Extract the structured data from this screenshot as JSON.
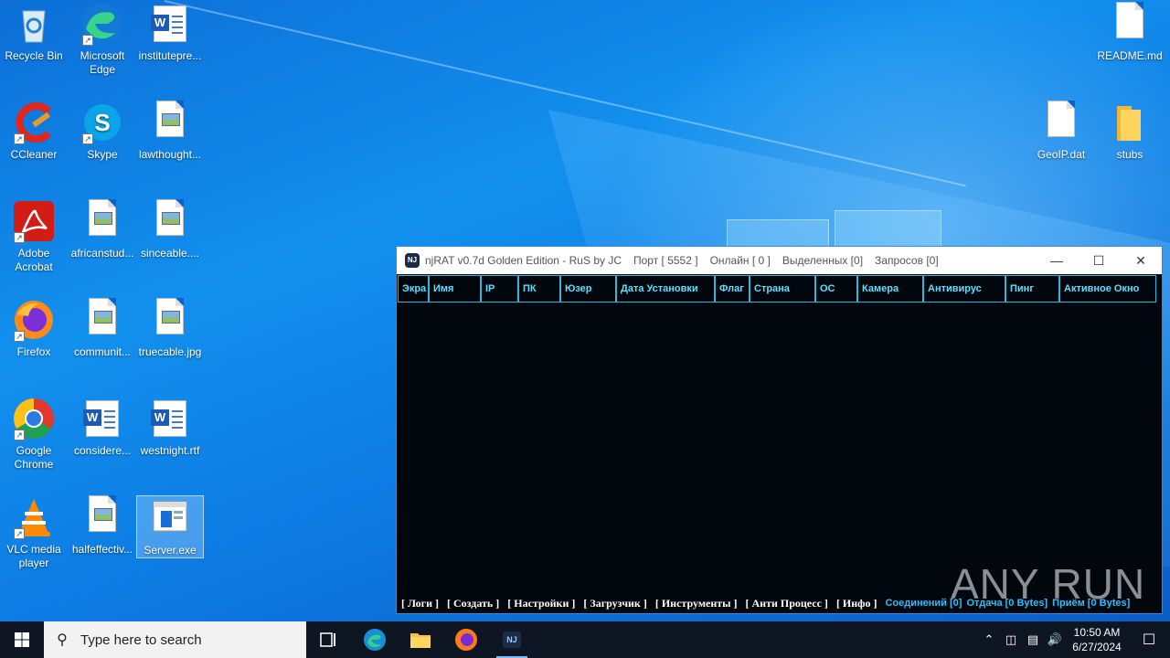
{
  "desktop": {
    "icons_left": [
      {
        "label": "Recycle Bin",
        "icon": "recycle-bin-icon"
      },
      {
        "label": "Microsoft Edge",
        "icon": "edge-icon"
      },
      {
        "label": "institutepre...",
        "icon": "word-doc-icon"
      },
      {
        "label": "CCleaner",
        "icon": "ccleaner-icon"
      },
      {
        "label": "Skype",
        "icon": "skype-icon"
      },
      {
        "label": "lawthought...",
        "icon": "image-file-icon"
      },
      {
        "label": "Adobe Acrobat",
        "icon": "acrobat-icon"
      },
      {
        "label": "africanstud...",
        "icon": "image-file-icon"
      },
      {
        "label": "sinceable....",
        "icon": "image-file-icon"
      },
      {
        "label": "Firefox",
        "icon": "firefox-icon"
      },
      {
        "label": "communit...",
        "icon": "image-file-icon"
      },
      {
        "label": "truecable.jpg",
        "icon": "image-file-icon"
      },
      {
        "label": "Google Chrome",
        "icon": "chrome-icon"
      },
      {
        "label": "considere...",
        "icon": "word-doc-icon"
      },
      {
        "label": "westnight.rtf",
        "icon": "word-doc-icon"
      },
      {
        "label": "VLC media player",
        "icon": "vlc-icon"
      },
      {
        "label": "halfeffectiv...",
        "icon": "image-file-icon"
      },
      {
        "label": "Server.exe",
        "icon": "exe-icon"
      }
    ],
    "icons_right": [
      {
        "label": "README.md",
        "icon": "text-file-icon"
      },
      {
        "label": "GeoIP.dat",
        "icon": "text-file-icon"
      },
      {
        "label": "stubs",
        "icon": "folder-icon"
      }
    ]
  },
  "app": {
    "title": "njRAT v0.7d Golden Edition - RuS by JC",
    "port": "Порт [ 5552 ]",
    "online": "Онлайн [ 0 ]",
    "selected": "Выделенных [0]",
    "requests": "Запросов [0]",
    "columns": [
      "Экра",
      "Имя",
      "IP",
      "ПК",
      "Юзер",
      "Дата Установки",
      "Флаг",
      "Страна",
      "ОС",
      "Камера",
      "Антивирус",
      "Пинг",
      "Активное Окно"
    ],
    "menu": [
      "[ Логи ]",
      "[ Создать ]",
      "[ Настройки ]",
      "[ Загрузчик ]",
      "[ Инструменты ]",
      "[ Анти Процесс ]",
      "[ Инфо ]"
    ],
    "status": {
      "connections": "Соединений [0]",
      "upload": "Отдача [0 Bytes]",
      "download": "Приём [0 Bytes]"
    }
  },
  "watermark": "ANY RUN",
  "taskbar": {
    "search_placeholder": "Type here to search",
    "time": "10:50 AM",
    "date": "6/27/2024"
  }
}
